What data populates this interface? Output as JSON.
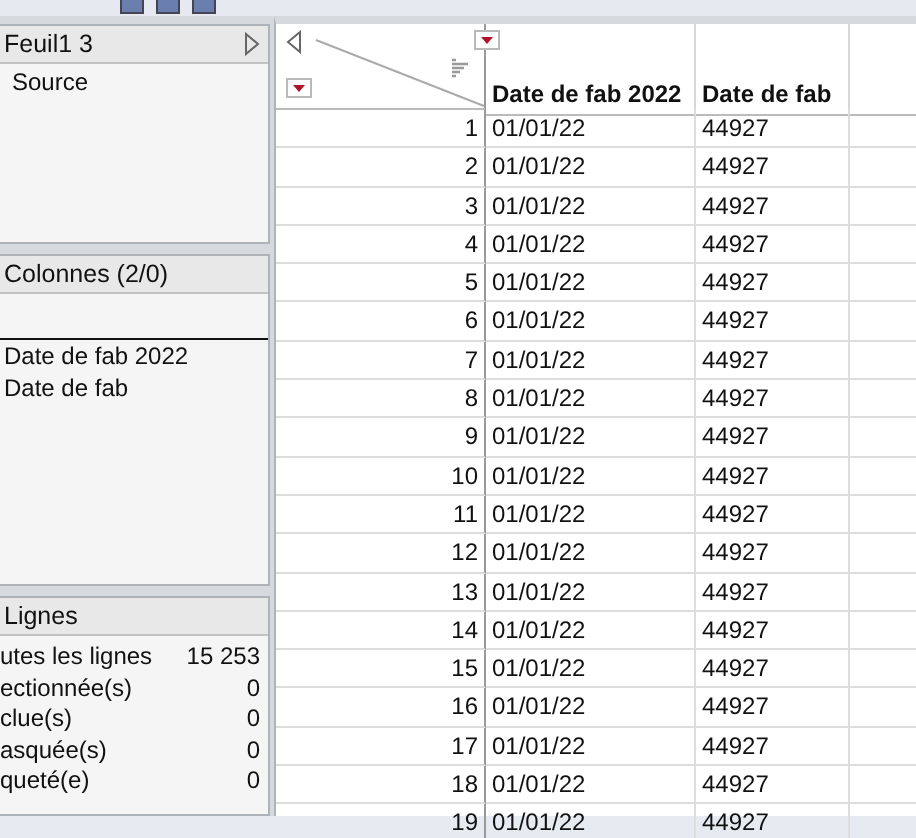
{
  "table_panel": {
    "title": "Feuil1 3",
    "items": [
      "Source"
    ]
  },
  "columns_panel": {
    "title": "Colonnes (2/0)",
    "items": [
      "Date de fab 2022",
      "Date de fab"
    ]
  },
  "rows_panel": {
    "title": "Lignes",
    "stats": [
      {
        "label": "utes les lignes",
        "value": "15 253"
      },
      {
        "label": "ectionnée(s)",
        "value": "0"
      },
      {
        "label": "clue(s)",
        "value": "0"
      },
      {
        "label": "asquée(s)",
        "value": "0"
      },
      {
        "label": "queté(e)",
        "value": "0"
      }
    ]
  },
  "table": {
    "columns": [
      "Date de fab 2022",
      "Date de fab"
    ],
    "rows": [
      {
        "n": "1",
        "cells": [
          "01/01/22",
          "44927"
        ]
      },
      {
        "n": "2",
        "cells": [
          "01/01/22",
          "44927"
        ]
      },
      {
        "n": "3",
        "cells": [
          "01/01/22",
          "44927"
        ]
      },
      {
        "n": "4",
        "cells": [
          "01/01/22",
          "44927"
        ]
      },
      {
        "n": "5",
        "cells": [
          "01/01/22",
          "44927"
        ]
      },
      {
        "n": "6",
        "cells": [
          "01/01/22",
          "44927"
        ]
      },
      {
        "n": "7",
        "cells": [
          "01/01/22",
          "44927"
        ]
      },
      {
        "n": "8",
        "cells": [
          "01/01/22",
          "44927"
        ]
      },
      {
        "n": "9",
        "cells": [
          "01/01/22",
          "44927"
        ]
      },
      {
        "n": "10",
        "cells": [
          "01/01/22",
          "44927"
        ]
      },
      {
        "n": "11",
        "cells": [
          "01/01/22",
          "44927"
        ]
      },
      {
        "n": "12",
        "cells": [
          "01/01/22",
          "44927"
        ]
      },
      {
        "n": "13",
        "cells": [
          "01/01/22",
          "44927"
        ]
      },
      {
        "n": "14",
        "cells": [
          "01/01/22",
          "44927"
        ]
      },
      {
        "n": "15",
        "cells": [
          "01/01/22",
          "44927"
        ]
      },
      {
        "n": "16",
        "cells": [
          "01/01/22",
          "44927"
        ]
      },
      {
        "n": "17",
        "cells": [
          "01/01/22",
          "44927"
        ]
      },
      {
        "n": "18",
        "cells": [
          "01/01/22",
          "44927"
        ]
      },
      {
        "n": "19",
        "cells": [
          "01/01/22",
          "44927"
        ]
      }
    ]
  }
}
